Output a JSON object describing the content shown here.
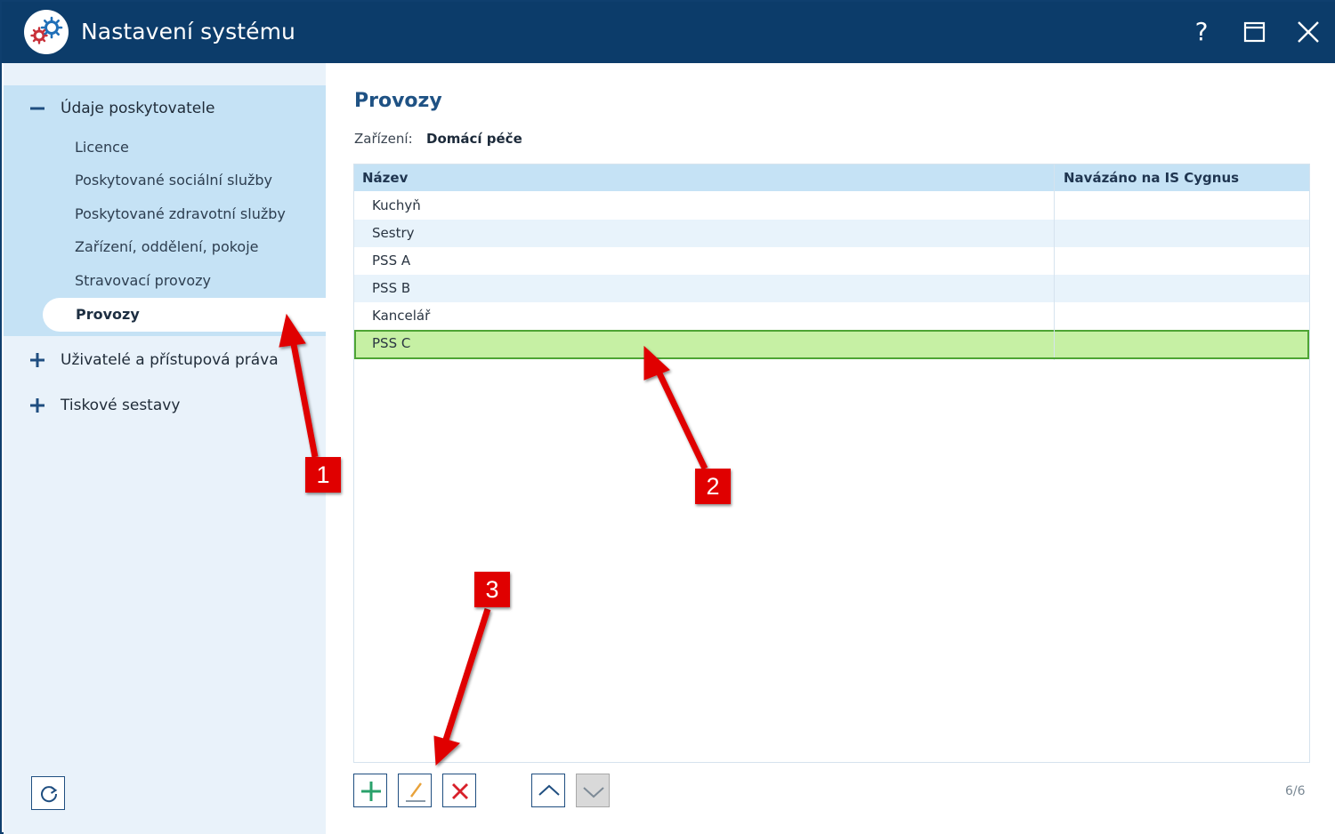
{
  "window": {
    "title": "Nastavení systému",
    "help_label": "?",
    "icons": [
      "app-gear-icon",
      "help-icon",
      "maximize-icon",
      "close-icon"
    ]
  },
  "sidebar": {
    "groups": [
      {
        "label": "Údaje poskytovatele",
        "state": "expanded",
        "items": [
          {
            "label": "Licence"
          },
          {
            "label": "Poskytované sociální služby"
          },
          {
            "label": "Poskytované zdravotní služby"
          },
          {
            "label": "Zařízení, oddělení, pokoje"
          },
          {
            "label": "Stravovací provozy"
          },
          {
            "label": "Provozy",
            "active": true
          }
        ]
      },
      {
        "label": "Uživatelé a přístupová práva",
        "state": "collapsed"
      },
      {
        "label": "Tiskové sestavy",
        "state": "collapsed"
      }
    ],
    "refresh_icon": "refresh-icon"
  },
  "main": {
    "title": "Provozy",
    "facility_label": "Zařízení:",
    "facility_value": "Domácí péče",
    "table": {
      "columns": [
        "Název",
        "Navázáno na IS Cygnus"
      ],
      "rows": [
        {
          "name": "Kuchyň",
          "linked": ""
        },
        {
          "name": "Sestry",
          "linked": ""
        },
        {
          "name": "PSS A",
          "linked": ""
        },
        {
          "name": "PSS B",
          "linked": ""
        },
        {
          "name": "Kancelář",
          "linked": ""
        },
        {
          "name": "PSS C",
          "linked": "",
          "selected": true
        }
      ]
    },
    "toolbar": {
      "buttons": [
        "add-icon",
        "edit-icon",
        "delete-icon",
        "move-up-icon",
        "move-down-icon"
      ]
    },
    "pager": "6/6"
  },
  "annotations": {
    "badges": [
      "1",
      "2",
      "3"
    ]
  },
  "colors": {
    "titlebar": "#0c3c6a",
    "sidebar_bg": "#e9f2fa",
    "sidebar_group": "#c5e2f5",
    "selected_row": "#c6f0a4",
    "selected_border": "#4ea434",
    "accent_title": "#1f5284",
    "add": "#2aa16b",
    "edit": "#e8a23a",
    "delete": "#d8202a",
    "annotation": "#e00000"
  }
}
